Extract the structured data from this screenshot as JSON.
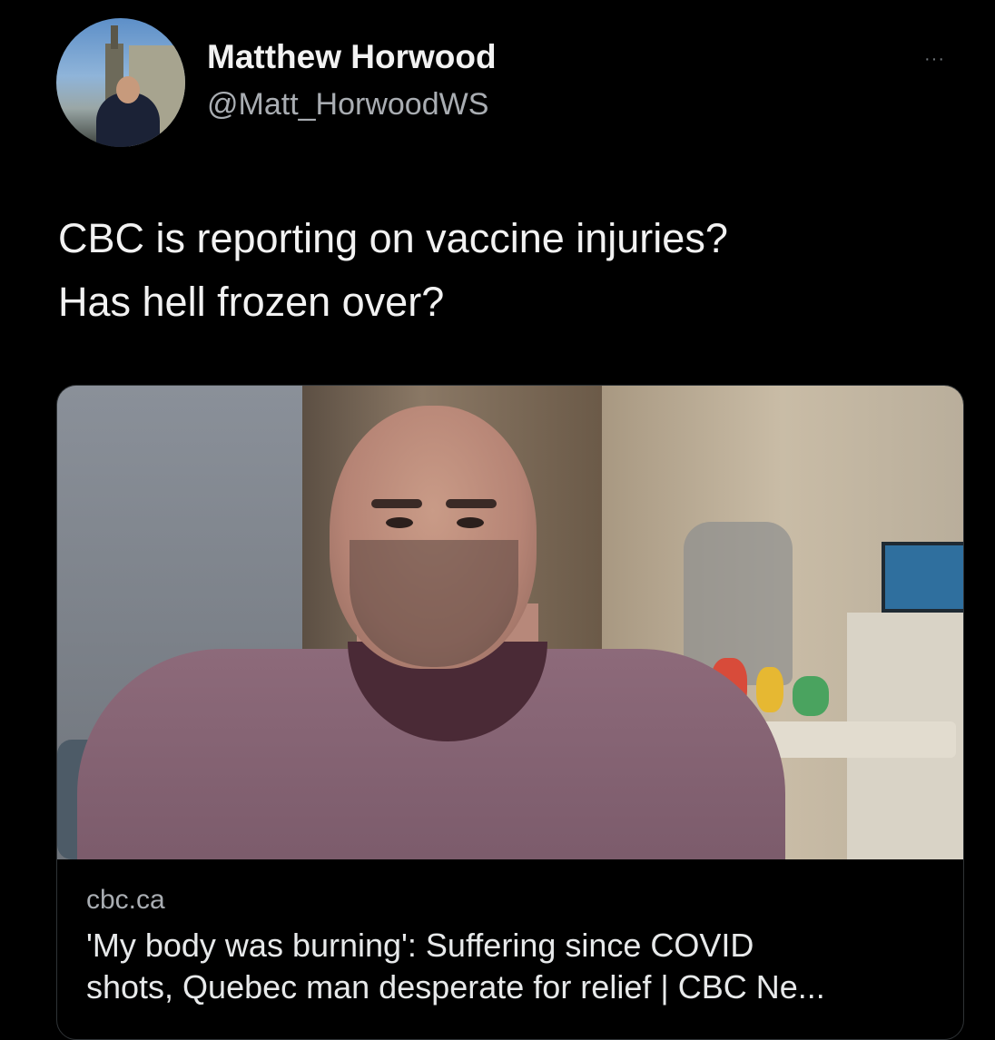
{
  "author": {
    "name": "Matthew Horwood",
    "handle": "@Matt_HorwoodWS"
  },
  "menu_label": "···",
  "tweet": {
    "lines": [
      "CBC is reporting on vaccine injuries?",
      "Has hell frozen over?"
    ]
  },
  "link_card": {
    "domain": "cbc.ca",
    "headline_lines": [
      "'My body was burning': Suffering since COVID",
      "shots, Quebec man desperate for relief | CBC Ne..."
    ]
  },
  "colors": {
    "background": "#000000",
    "text_primary": "#f2f2f2",
    "text_secondary": "#a9adb2",
    "card_border": "#2f3336"
  }
}
